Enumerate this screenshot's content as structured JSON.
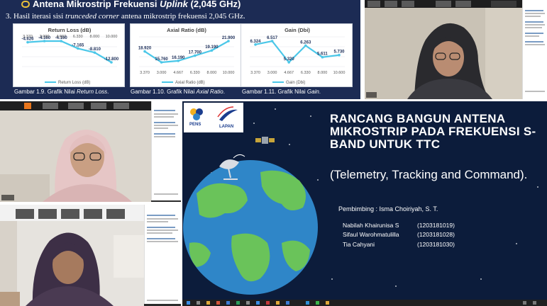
{
  "slide_top": {
    "heading_prefix": "Antena Mikrostrip Frekuensi ",
    "heading_italic": "Uplink",
    "heading_suffix": " (2,045 GHz)",
    "subheading_prefix": "3. Hasil iterasi sisi ",
    "subheading_italic": "trunceded corner",
    "subheading_suffix": " antena mikrostrip frekuensi 2,045 GHz.",
    "captions": [
      {
        "prefix": "Gambar 1.9.  Grafik Nilai ",
        "italic": "Return Loss",
        "suffix": "."
      },
      {
        "prefix": "Gambar 1.10.  Grafik Nilai ",
        "italic": "Axial Ratio",
        "suffix": "."
      },
      {
        "prefix": "Gambar 1.11.  Grafik Nilai ",
        "italic": "Gain",
        "suffix": "."
      }
    ]
  },
  "chart_data": [
    {
      "type": "line",
      "title": "Return Loss (dB)",
      "x": [
        "3.370",
        "3.000",
        "4.667",
        "6.330",
        "8.000",
        "10.000"
      ],
      "series": [
        {
          "name": "Return Loss (dB)",
          "values": [
            -4.626,
            -4.16,
            -4.16,
            -7.165,
            -8.81,
            -12.8
          ]
        }
      ],
      "data_labels": [
        "-4.626",
        "-4.160",
        "-4.160",
        "-7.165",
        "-8.810",
        "-12.800"
      ],
      "x_position": "top",
      "legend": "bottom",
      "color": "#4bc7e8"
    },
    {
      "type": "line",
      "title": "Axial Ratio (dB)",
      "x": [
        "3.370",
        "3.000",
        "4.667",
        "6.330",
        "8.000",
        "10.000"
      ],
      "series": [
        {
          "name": "Axial Ratio (dB)",
          "values": [
            18.92,
            15.76,
            16.19,
            17.7,
            19.19,
            21.9
          ]
        }
      ],
      "data_labels": [
        "18.920",
        "15.760",
        "16.190",
        "17.700",
        "19.190",
        "21.900"
      ],
      "x_position": "bottom",
      "legend": "bottom",
      "color": "#4bc7e8"
    },
    {
      "type": "line",
      "title": "Gain (Dbi)",
      "x": [
        "3.370",
        "3.000",
        "4.667",
        "6.330",
        "8.000",
        "10.600"
      ],
      "series": [
        {
          "name": "Gain (Dbi)",
          "values": [
            6.324,
            6.517,
            5.32,
            6.263,
            5.611,
            5.73
          ]
        }
      ],
      "data_labels": [
        "6.324",
        "6.517",
        "5.320",
        "6.263",
        "5.611",
        "5.730"
      ],
      "x_position": "bottom",
      "legend": "bottom",
      "color": "#4bc7e8"
    }
  ],
  "slide_main": {
    "logo_left": "PENS",
    "logo_right": "LAPAN",
    "title": "RANCANG BANGUN ANTENA MIKROSTRIP PADA FREKUENSI S-BAND UNTUK TTC",
    "subtitle": "(Telemetry, Tracking and Command).",
    "advisor": "Pembimbing : Isma Choiriyah, S. T.",
    "members": [
      {
        "name": "Nabilah Khairunisa S",
        "nim": "(1203181019)"
      },
      {
        "name": "Sifaul Warohmatulilla",
        "nim": "(1203181028)"
      },
      {
        "name": "Tia Cahyani",
        "nim": "(1203181030)"
      }
    ]
  },
  "colors": {
    "slide_navy": "#1c2b54",
    "title_slide_bg": "#0c1c3b",
    "chart_line": "#4bc7e8",
    "clip_icon": "#e9c13a"
  }
}
